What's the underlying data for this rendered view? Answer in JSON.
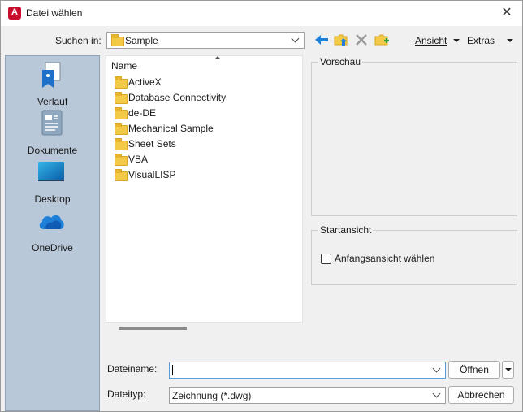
{
  "window": {
    "title": "Datei wählen"
  },
  "lookin": {
    "label": "Suchen in:",
    "value": "Sample"
  },
  "toolbar": {
    "back": "back-arrow-icon",
    "up": "folder-up-icon",
    "delete": "delete-icon",
    "new_folder": "new-folder-icon",
    "view_label": "Ansicht",
    "tools_label": "Extras"
  },
  "places": [
    {
      "label": "Verlauf",
      "icon": "history-icon"
    },
    {
      "label": "Dokumente",
      "icon": "documents-icon"
    },
    {
      "label": "Desktop",
      "icon": "desktop-icon"
    },
    {
      "label": "OneDrive",
      "icon": "onedrive-icon"
    }
  ],
  "filelist": {
    "column_header": "Name",
    "items": [
      {
        "name": "ActiveX"
      },
      {
        "name": "Database Connectivity"
      },
      {
        "name": "de-DE"
      },
      {
        "name": "Mechanical Sample"
      },
      {
        "name": "Sheet Sets"
      },
      {
        "name": "VBA"
      },
      {
        "name": "VisualLISP"
      }
    ]
  },
  "preview": {
    "label": "Vorschau"
  },
  "startview": {
    "label": "Startansicht",
    "checkbox_label": "Anfangsansicht wählen",
    "checked": false
  },
  "filename": {
    "label": "Dateiname:",
    "value": ""
  },
  "filetype": {
    "label": "Dateityp:",
    "value": "Zeichnung (*.dwg)"
  },
  "buttons": {
    "open": "Öffnen",
    "cancel": "Abbrechen"
  },
  "colors": {
    "places_bg": "#b8c8d8",
    "accent_blue": "#1e7fd8",
    "folder": "#f3c948"
  }
}
